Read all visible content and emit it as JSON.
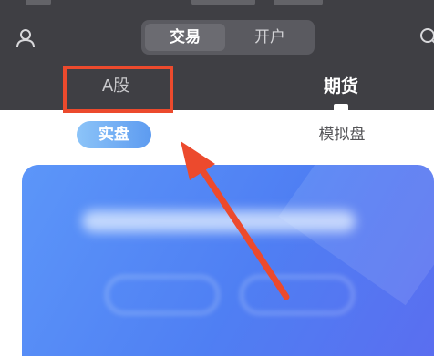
{
  "header": {
    "segment": {
      "trade_label": "交易",
      "open_account_label": "开户"
    },
    "market_tabs": {
      "a_share_label": "A股",
      "futures_label": "期货",
      "active": "期货"
    },
    "icons": {
      "left": "user-icon",
      "right": "search-icon"
    }
  },
  "sub_tabs": {
    "real_label": "实盘",
    "simulated_label": "模拟盘",
    "active": "实盘"
  },
  "annotation": {
    "highlight_color": "#ec4a2d",
    "target": "A股"
  },
  "colors": {
    "header_bg": "#3f3f44",
    "card_start": "#5c96f9",
    "card_end": "#5a6ef0",
    "accent_red": "#ec4a2d"
  }
}
